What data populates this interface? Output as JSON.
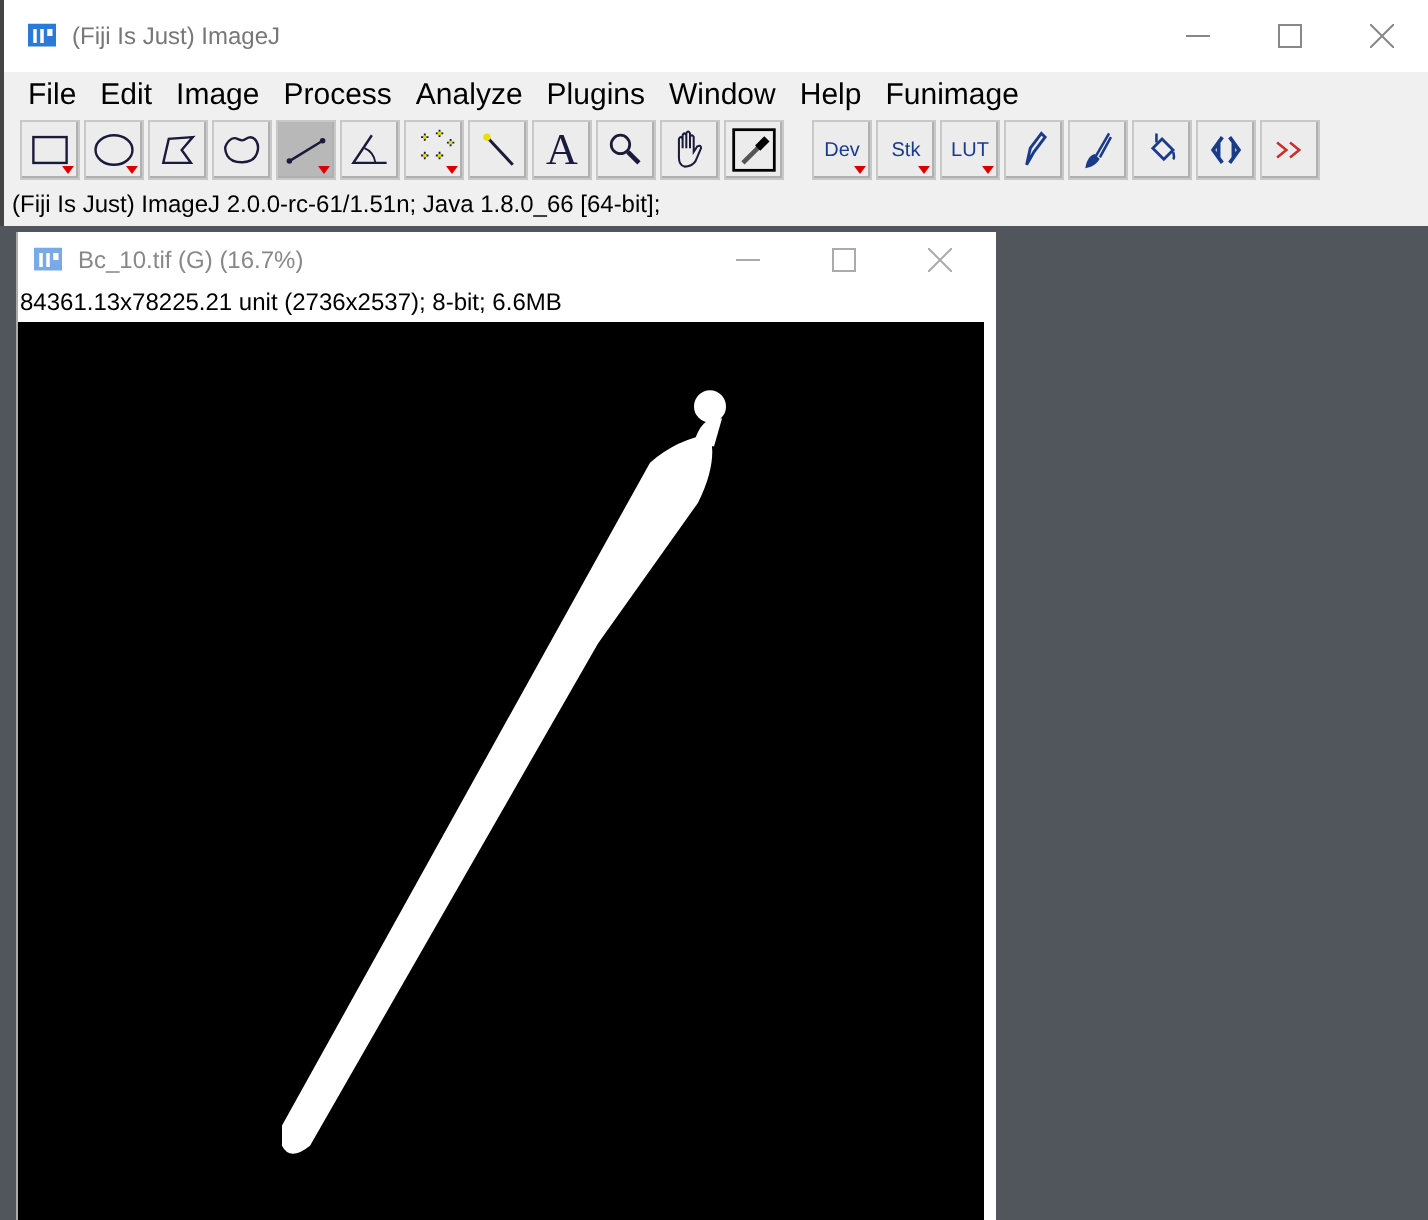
{
  "window": {
    "title": "(Fiji Is Just) ImageJ"
  },
  "menu": [
    "File",
    "Edit",
    "Image",
    "Process",
    "Analyze",
    "Plugins",
    "Window",
    "Help",
    "Funimage"
  ],
  "tools": [
    {
      "kind": "icon",
      "selected": false,
      "menu": true
    },
    {
      "kind": "icon",
      "selected": false,
      "menu": true
    },
    {
      "kind": "icon",
      "selected": false,
      "menu": false
    },
    {
      "kind": "icon",
      "selected": false,
      "menu": false
    },
    {
      "kind": "icon",
      "selected": true,
      "menu": true
    },
    {
      "kind": "icon",
      "selected": false,
      "menu": false
    },
    {
      "kind": "icon",
      "selected": false,
      "menu": true
    },
    {
      "kind": "icon",
      "selected": false,
      "menu": false
    },
    {
      "kind": "text",
      "label": "A",
      "selected": false,
      "menu": false
    },
    {
      "kind": "icon",
      "selected": false,
      "menu": false
    },
    {
      "kind": "icon",
      "selected": false,
      "menu": false
    },
    {
      "kind": "icon",
      "selected": false,
      "menu": false
    }
  ],
  "plugin_tools": [
    {
      "kind": "text",
      "label": "Dev",
      "menu": true
    },
    {
      "kind": "text",
      "label": "Stk",
      "menu": true
    },
    {
      "kind": "text",
      "label": "LUT",
      "menu": true
    },
    {
      "kind": "icon",
      "menu": false
    },
    {
      "kind": "icon",
      "menu": false
    },
    {
      "kind": "icon",
      "menu": false
    },
    {
      "kind": "icon",
      "menu": false
    },
    {
      "kind": "icon",
      "menu": false
    }
  ],
  "status_bar": "(Fiji Is Just) ImageJ 2.0.0-rc-61/1.51n; Java 1.8.0_66 [64-bit];",
  "image_window": {
    "title": "Bc_10.tif (G) (16.7%)",
    "info": "84361.13x78225.21 unit (2736x2537); 8-bit; 6.6MB"
  }
}
